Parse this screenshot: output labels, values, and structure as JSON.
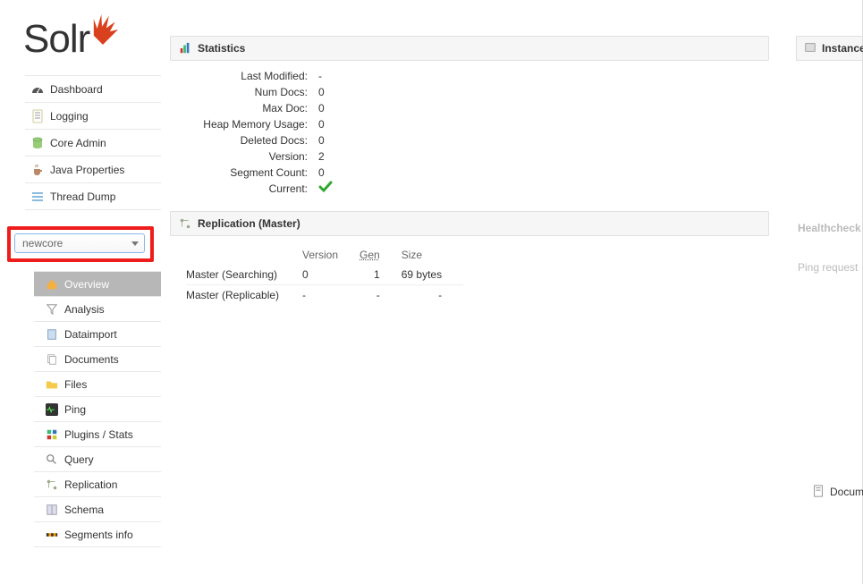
{
  "logo_text": "Solr",
  "nav": {
    "dashboard": "Dashboard",
    "logging": "Logging",
    "core_admin": "Core Admin",
    "java_properties": "Java Properties",
    "thread_dump": "Thread Dump"
  },
  "core_selector": {
    "value": "newcore"
  },
  "subnav": {
    "overview": "Overview",
    "analysis": "Analysis",
    "dataimport": "Dataimport",
    "documents": "Documents",
    "files": "Files",
    "ping": "Ping",
    "plugins": "Plugins / Stats",
    "query": "Query",
    "replication": "Replication",
    "schema": "Schema",
    "segments": "Segments info"
  },
  "stats": {
    "title": "Statistics",
    "rows": {
      "last_modified": {
        "label": "Last Modified:",
        "value": "-"
      },
      "num_docs": {
        "label": "Num Docs:",
        "value": "0"
      },
      "max_doc": {
        "label": "Max Doc:",
        "value": "0"
      },
      "heap": {
        "label": "Heap Memory Usage:",
        "value": "0"
      },
      "deleted": {
        "label": "Deleted Docs:",
        "value": "0"
      },
      "version": {
        "label": "Version:",
        "value": "2"
      },
      "segment": {
        "label": "Segment Count:",
        "value": "0"
      },
      "current": {
        "label": "Current:",
        "value": "✔"
      }
    }
  },
  "replication": {
    "title": "Replication (Master)",
    "headers": {
      "version": "Version",
      "gen": "Gen",
      "size": "Size"
    },
    "rows": [
      {
        "name": "Master (Searching)",
        "version": "0",
        "gen": "1",
        "size": "69 bytes"
      },
      {
        "name": "Master (Replicable)",
        "version": "-",
        "gen": "-",
        "size": "-"
      }
    ]
  },
  "right": {
    "instance": "Instance",
    "healthcheck": "Healthcheck",
    "ping": "Ping request",
    "docu": "Documentation"
  }
}
